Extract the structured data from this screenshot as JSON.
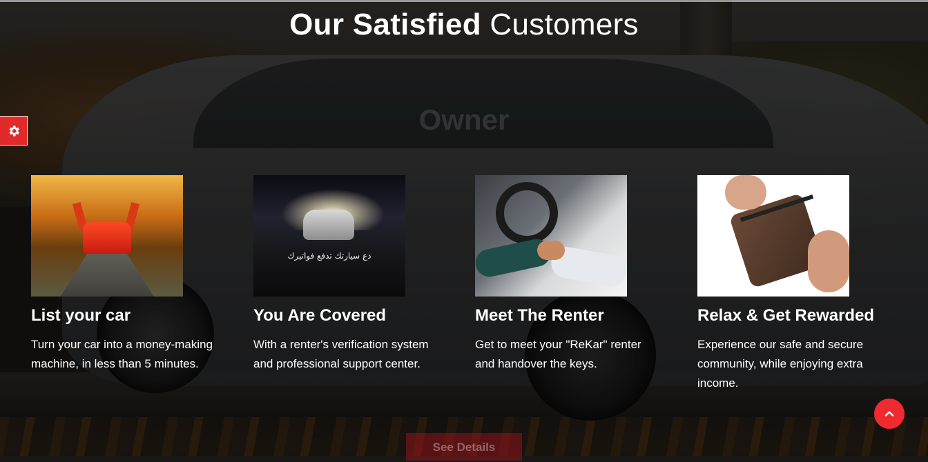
{
  "section": {
    "title_bold": "Our Satisfied",
    "title_rest": "Customers",
    "ghost_label": "Owner"
  },
  "cards": [
    {
      "title": "List your car",
      "text": "Turn your car into a money-making machine, in less than 5 minutes.",
      "image": "red-sports-car-photo"
    },
    {
      "title": "You Are Covered",
      "text": "With a renter's verification system and professional support center.",
      "image_caption": "دع سيارتك تدفع فواتيرك",
      "image": "night-car-photo"
    },
    {
      "title": "Meet The Renter",
      "text": "Get to meet your \"ReKar\" renter and handover the keys.",
      "image": "key-handover-photo"
    },
    {
      "title": "Relax & Get Rewarded",
      "text": "Experience our safe and secure community, while enjoying extra income.",
      "image": "wallet-photo"
    }
  ],
  "buttons": {
    "see_details": "See Details"
  },
  "icons": {
    "settings": "gear-icon",
    "scroll_top": "chevron-up-icon"
  },
  "colors": {
    "accent_red": "#f02a2e",
    "settings_red": "#e02b2b",
    "text": "#ffffff"
  }
}
